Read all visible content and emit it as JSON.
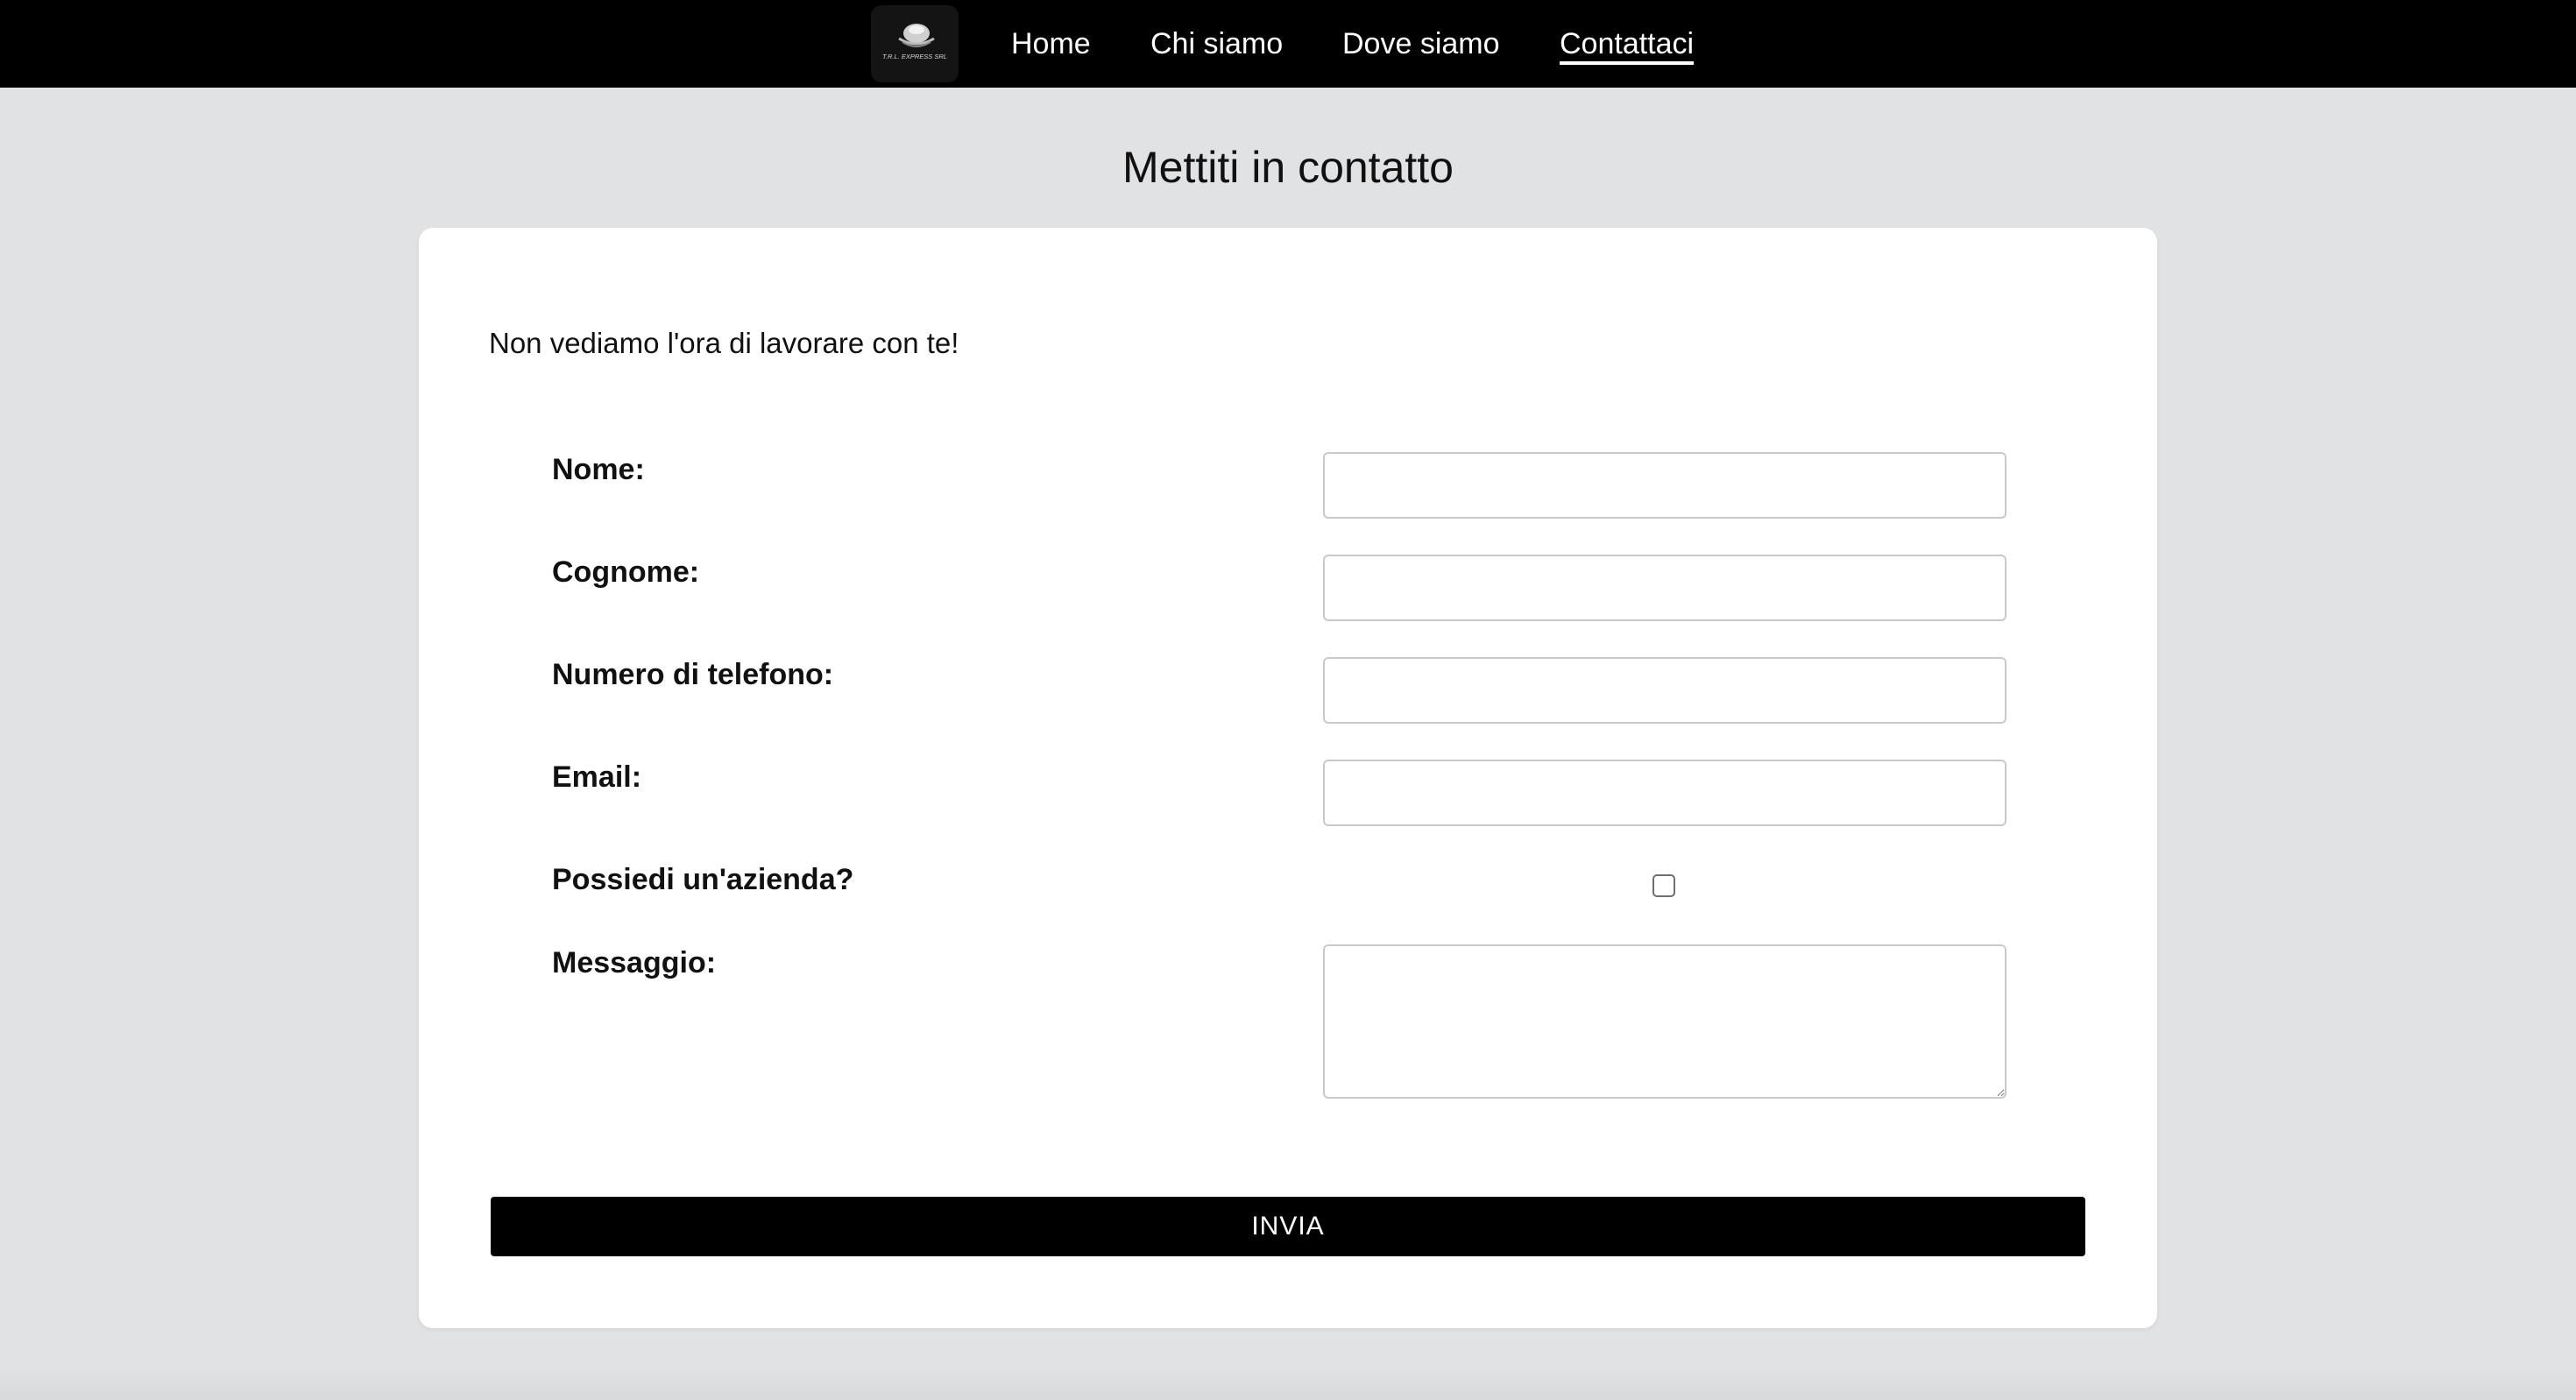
{
  "nav": {
    "logo_text": "T.R.L. EXPRESS SRL",
    "links": [
      {
        "label": "Home"
      },
      {
        "label": "Chi siamo"
      },
      {
        "label": "Dove siamo"
      },
      {
        "label": "Contattaci",
        "active": true
      }
    ]
  },
  "page": {
    "title": "Mettiti in contatto",
    "intro": "Non vediamo l'ora di lavorare con te!"
  },
  "form": {
    "fields": {
      "nome": {
        "label": "Nome:",
        "value": "",
        "placeholder": ""
      },
      "cognome": {
        "label": "Cognome:",
        "value": "",
        "placeholder": ""
      },
      "telefono": {
        "label": "Numero di telefono:",
        "value": "",
        "placeholder": ""
      },
      "email": {
        "label": "Email:",
        "value": "",
        "placeholder": ""
      },
      "azienda": {
        "label": "Possiedi un'azienda?",
        "checked": false
      },
      "messaggio": {
        "label": "Messaggio:",
        "value": "",
        "placeholder": ""
      }
    },
    "submit_label": "INVIA"
  },
  "colors": {
    "navbar": "#000000",
    "page_background": "#e1e2e4",
    "card": "#ffffff",
    "button": "#000000"
  }
}
